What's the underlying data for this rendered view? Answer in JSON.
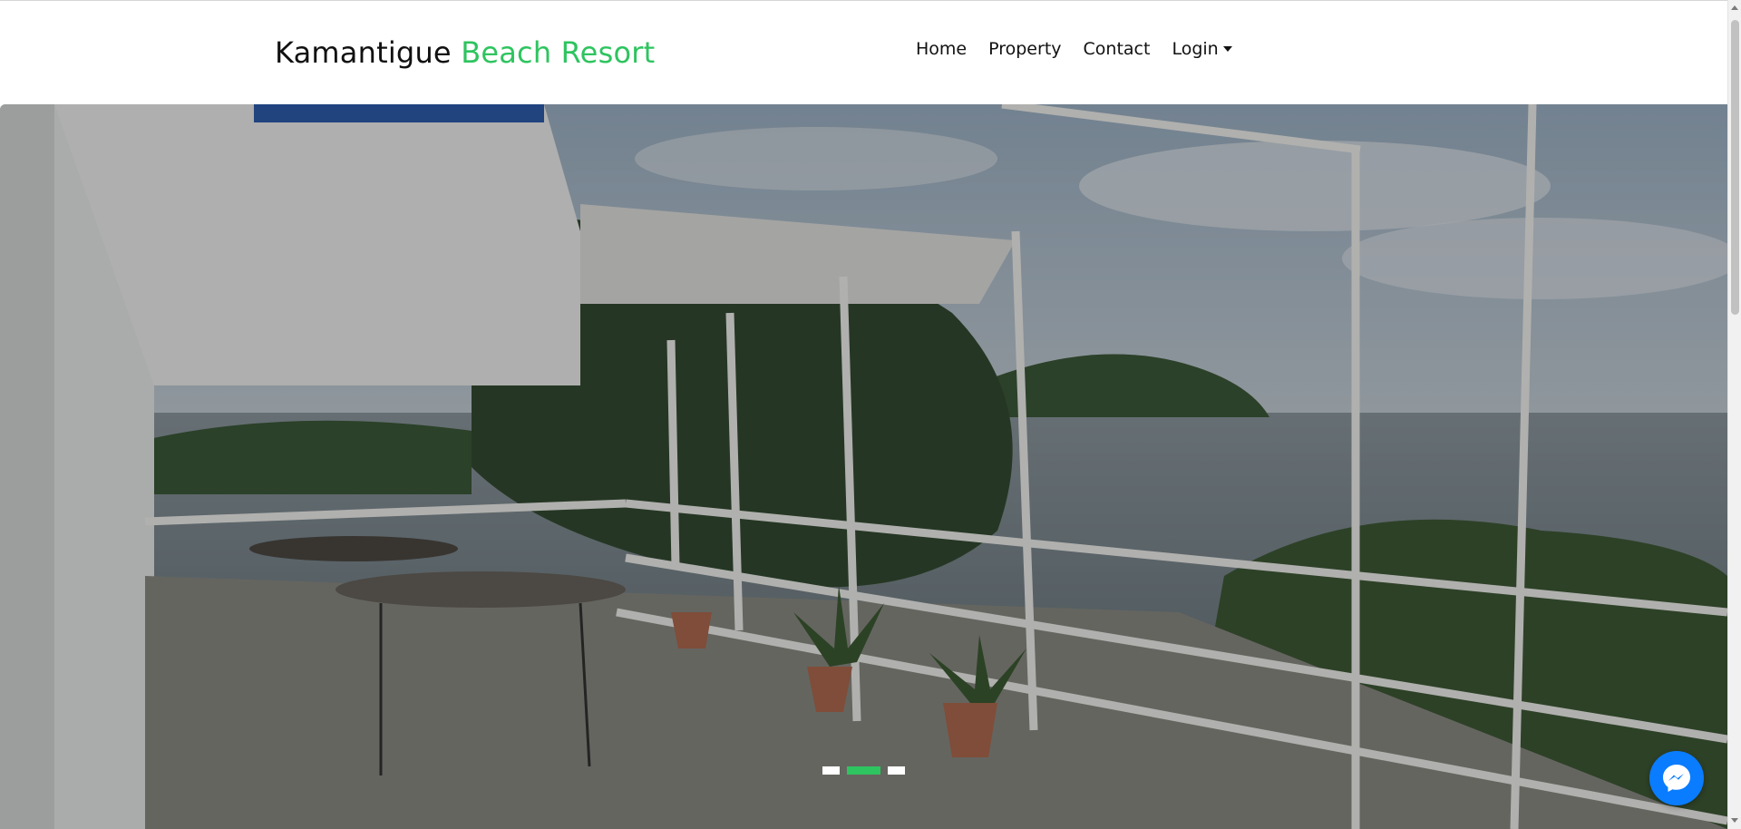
{
  "brand": {
    "name_main": "Kamantigue",
    "name_accent": "Beach Resort",
    "accent_color": "#2ec45f"
  },
  "nav": {
    "items": [
      {
        "label": "Home"
      },
      {
        "label": "Property"
      },
      {
        "label": "Contact"
      },
      {
        "label": "Login"
      }
    ]
  },
  "carousel": {
    "slide_count": 3,
    "active_index": 1,
    "image_description_icon": "photo-resort-terrace"
  },
  "chat": {
    "icon": "messenger-icon",
    "color": "#0a7cff"
  }
}
